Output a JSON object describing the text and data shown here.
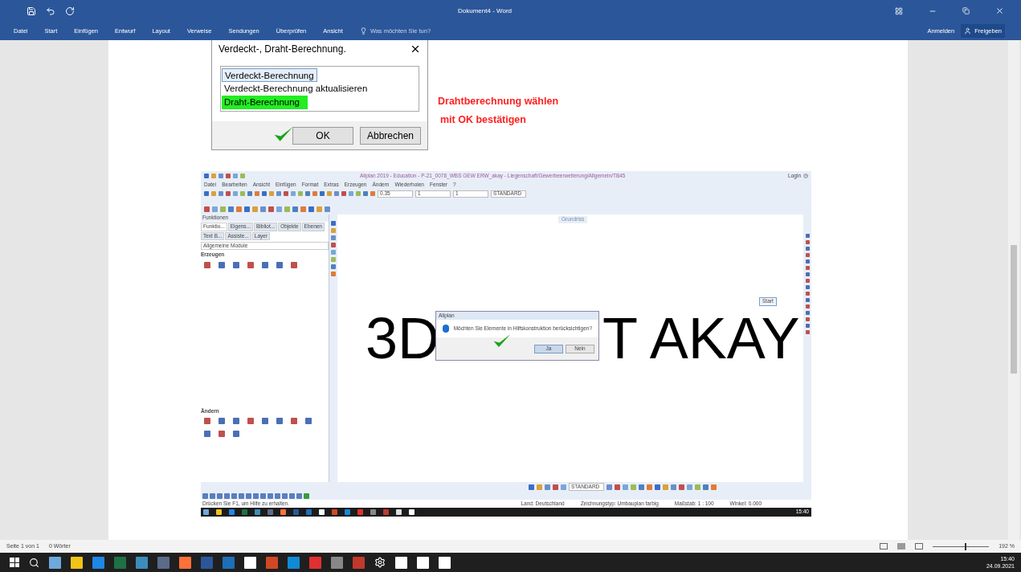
{
  "word": {
    "title": "Dokument4 - Word",
    "menu": [
      "Datei",
      "Start",
      "Einfügen",
      "Entwurf",
      "Layout",
      "Verweise",
      "Sendungen",
      "Überprüfen",
      "Ansicht"
    ],
    "tell_me": "Was möchten Sie tun?",
    "sign_in": "Anmelden",
    "share": "Freigeben"
  },
  "dialog": {
    "title": "Verdeckt-, Draht-Berechnung.",
    "options": [
      {
        "label": "Verdeckt-Berechnung",
        "selected": true,
        "highlighted": false
      },
      {
        "label": "Verdeckt-Berechnung aktualisieren",
        "selected": false,
        "highlighted": false
      },
      {
        "label": "Draht-Berechnung",
        "selected": false,
        "highlighted": true
      }
    ],
    "buttons": [
      "OK",
      "Abbrechen"
    ]
  },
  "note": [
    "Drahtberechnung wählen",
    "mit OK bestätigen"
  ],
  "allplan": {
    "title": "Allplan 2019 - Education - P-21_0078_WBS GEW ERW_akay - Liegenschaft/Gewerbeerweiterung/Allgemein/TB45",
    "login": "Login",
    "menu": [
      "Datei",
      "Bearbeiten",
      "Ansicht",
      "Einfügen",
      "Format",
      "Extras",
      "Erzeugen",
      "Ändern",
      "Wiederholen",
      "Fenster",
      "?"
    ],
    "toolbar_values": [
      "0.35",
      "1",
      "1",
      "STANDARD"
    ],
    "panel": {
      "title": "Funktionen",
      "tabs": [
        {
          "label": "Funktio...",
          "selected": true
        },
        {
          "label": "Eigens...",
          "selected": false
        },
        {
          "label": "Bibliot...",
          "selected": false
        },
        {
          "label": "Objekte",
          "selected": false
        },
        {
          "label": "Ebenen",
          "selected": false
        },
        {
          "label": "Text B...",
          "selected": false
        },
        {
          "label": "Assiste...",
          "selected": false
        },
        {
          "label": "Layer",
          "selected": false
        }
      ],
      "module": "Allgemeine Module",
      "sections": [
        {
          "title": "Erzeugen"
        },
        {
          "title": "Ändern"
        }
      ]
    },
    "view_tab": "Grundriss",
    "canvas_text": [
      "3D",
      "T AKAY"
    ],
    "start_button": "Start",
    "prompt": {
      "title": "Allplan",
      "message": "Möchten Sie Elemente in Hilfskonstruktion berücksichtigen?",
      "buttons": [
        "Ja",
        "Nein"
      ]
    },
    "bottom_style": "STANDARD",
    "status": [
      "Drücken Sie F1, um Hilfe zu erhalten.",
      "Land: Deutschland",
      "Zeichnungstyp: Umbauplan farbig",
      "Maßstab: 1 : 100",
      "Winkel: 0.000"
    ],
    "clock": "15:40"
  },
  "status_bar": {
    "page": "Seite 1 von 1",
    "words": "0 Wörter",
    "zoom": "192 %",
    "zoom_slider": {
      "level": 0.57
    }
  },
  "taskbar": {
    "time": "15:40",
    "date": "24.09.2021"
  }
}
